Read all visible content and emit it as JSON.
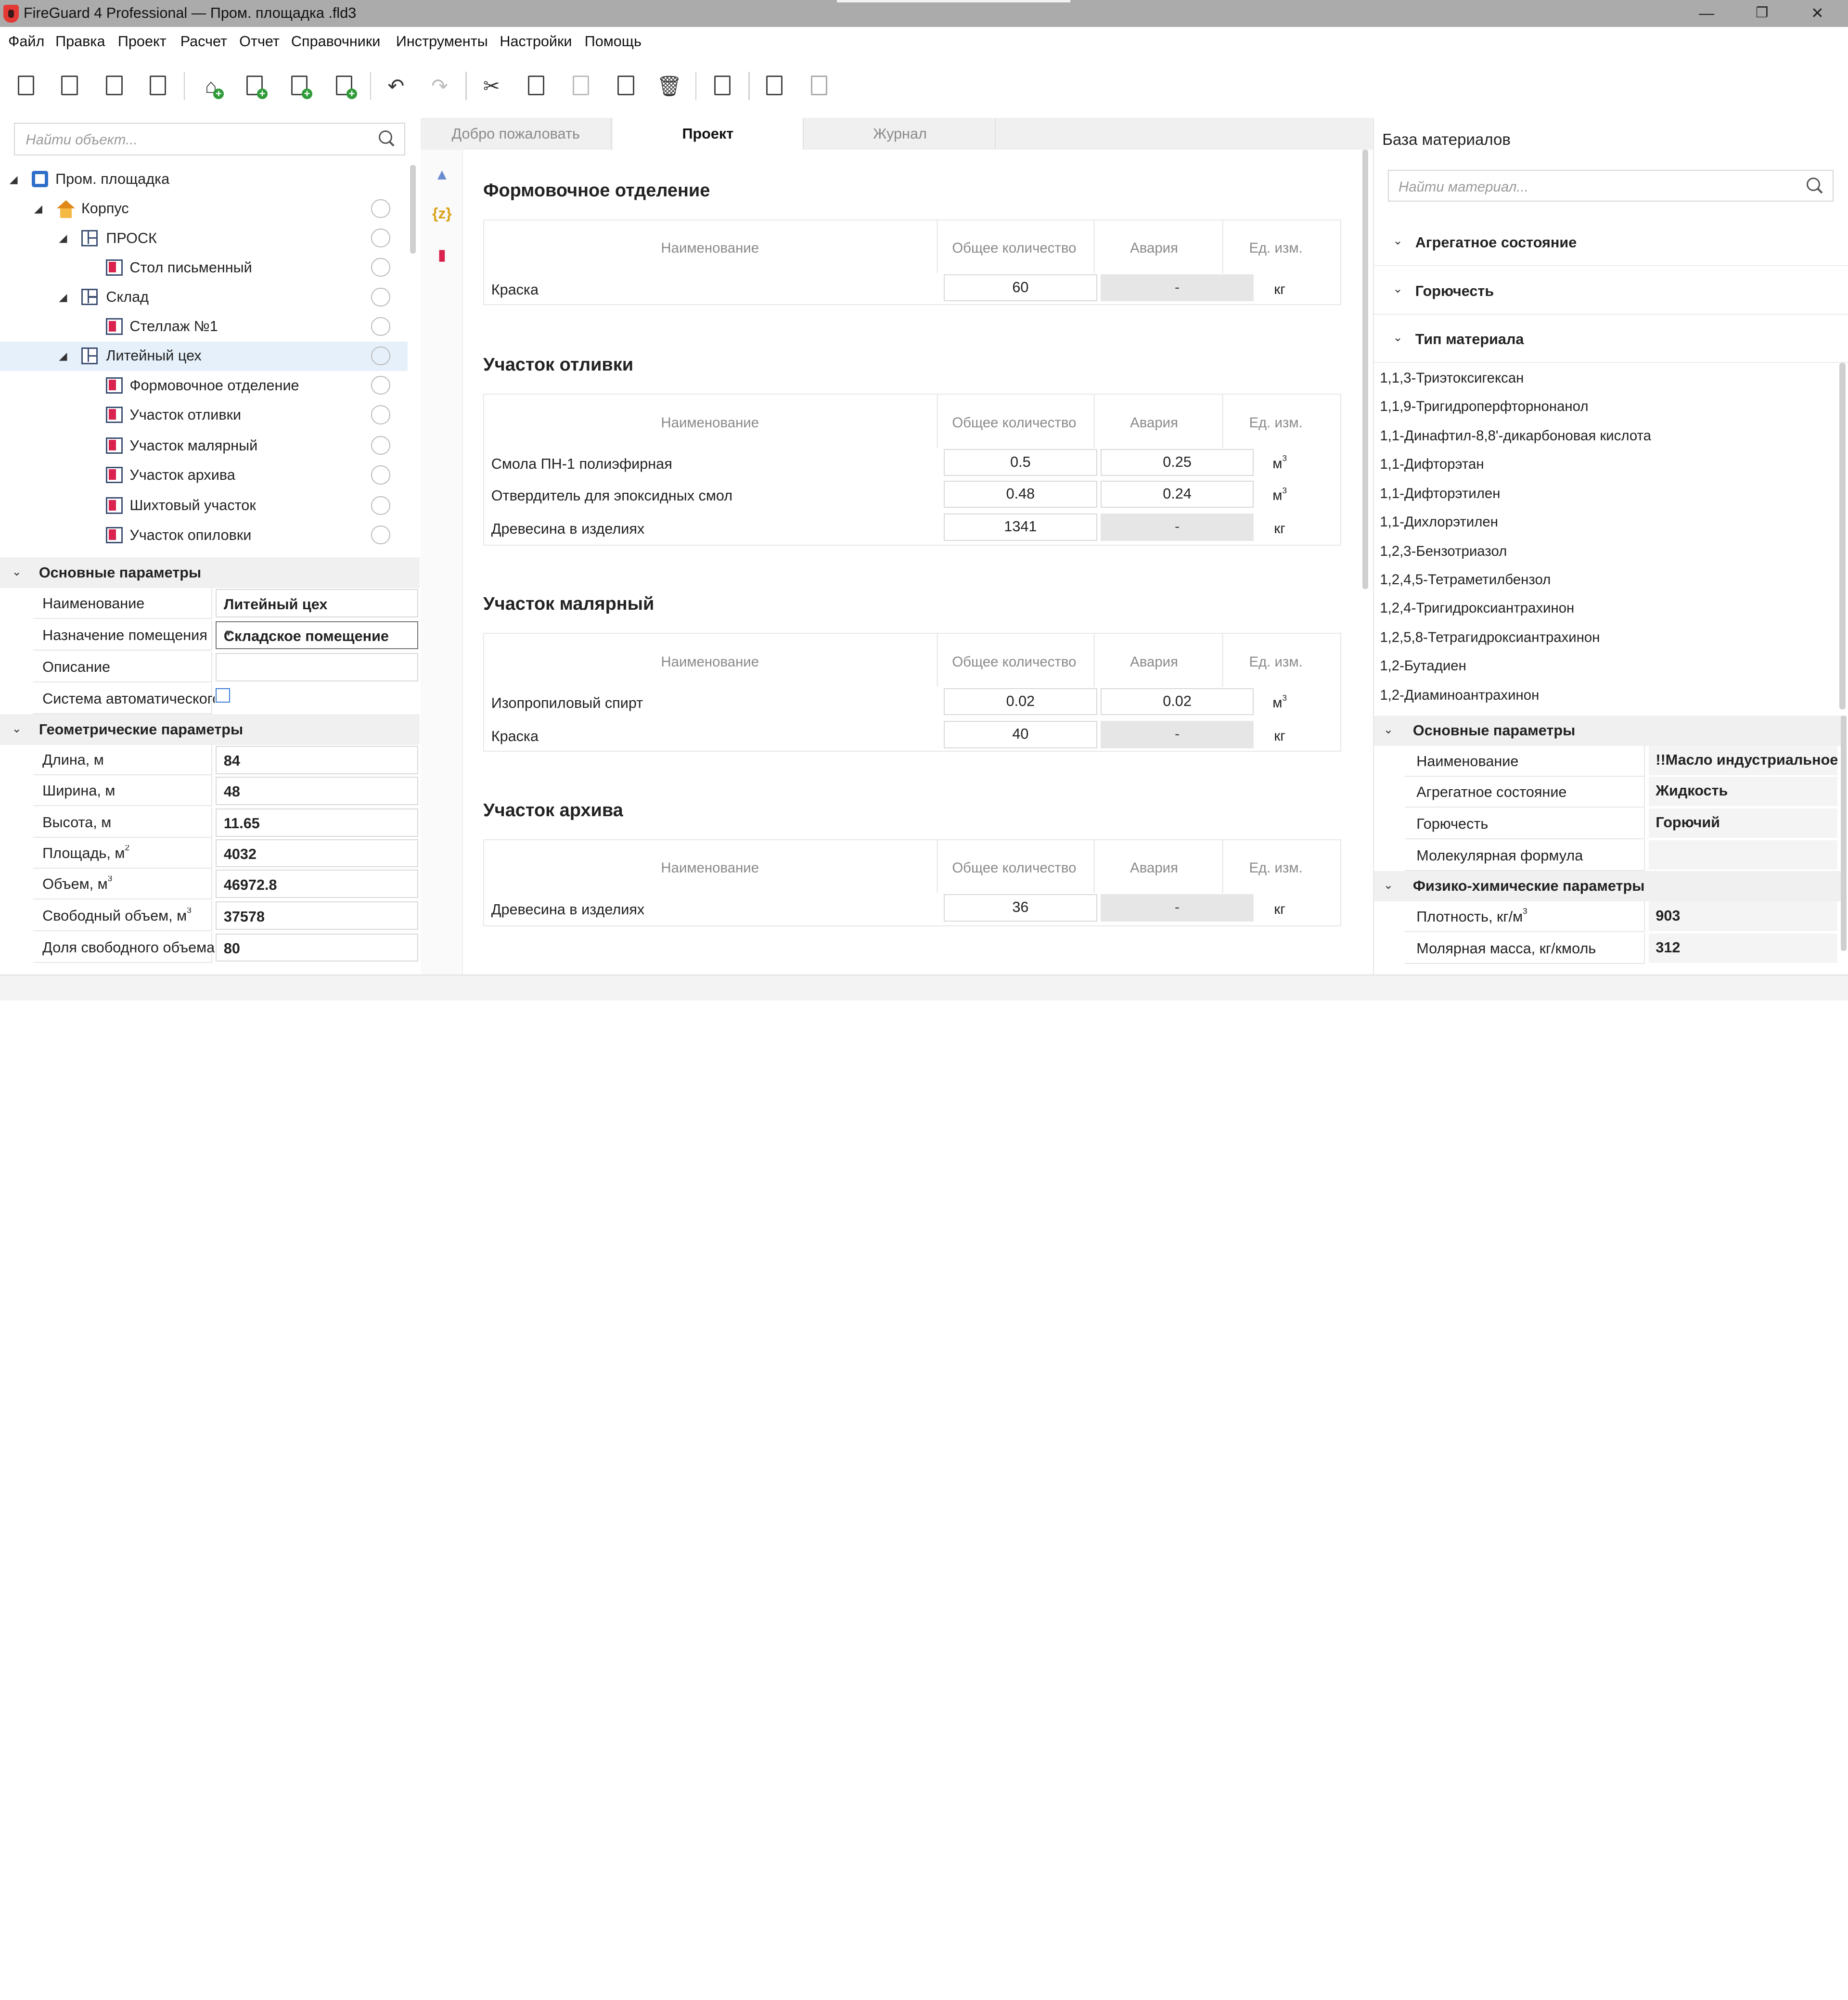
{
  "window": {
    "title": "FireGuard 4 Professional — Пром. площадка .fld3"
  },
  "menu": [
    "Файл",
    "Правка",
    "Проект",
    "Расчет",
    "Отчет",
    "Справочники",
    "Инструменты",
    "Настройки",
    "Помощь"
  ],
  "tree": {
    "search_placeholder": "Найти объект...",
    "items": [
      {
        "label": "Пром. площадка",
        "icon": "project-icon"
      },
      {
        "label": "Корпус",
        "icon": "house-icon"
      },
      {
        "label": "ПРОСК",
        "icon": "building-icon"
      },
      {
        "label": "Стол письменный",
        "icon": "room-icon"
      },
      {
        "label": "Склад",
        "icon": "building-icon"
      },
      {
        "label": "Стеллаж №1",
        "icon": "room-icon"
      },
      {
        "label": "Литейный цех",
        "icon": "building-icon"
      },
      {
        "label": "Формовочное отделение",
        "icon": "room-icon"
      },
      {
        "label": "Участок отливки",
        "icon": "room-icon"
      },
      {
        "label": "Участок малярный",
        "icon": "room-icon"
      },
      {
        "label": "Участок архива",
        "icon": "room-icon"
      },
      {
        "label": "Шихтовый участок",
        "icon": "room-icon"
      },
      {
        "label": "Участок опиловки",
        "icon": "room-icon"
      }
    ]
  },
  "basic": {
    "title": "Основные параметры",
    "rows": [
      {
        "label": "Наименование",
        "value": "Литейный цех"
      },
      {
        "label": "Назначение помещения",
        "value": "Складское помещение"
      },
      {
        "label": "Описание",
        "value": ""
      },
      {
        "label": "Система автоматического",
        "value": ""
      }
    ]
  },
  "geom": {
    "title": "Геометрические параметры",
    "rows": [
      {
        "label": "Длина, м",
        "value": "84"
      },
      {
        "label": "Ширина, м",
        "value": "48"
      },
      {
        "label": "Высота, м",
        "value": "11.65"
      },
      {
        "label": "Площадь, м",
        "sup": "2",
        "value": "4032"
      },
      {
        "label": "Объем, м",
        "sup": "3",
        "value": "46972.8"
      },
      {
        "label": "Свободный объем, м",
        "sup": "3",
        "value": "37578"
      },
      {
        "label": "Доля свободного объема",
        "value": "80"
      }
    ]
  },
  "tabs": [
    "Добро пожаловать",
    "Проект",
    "Журнал"
  ],
  "headers": {
    "name": "Наименование",
    "total": "Общее количество",
    "alarm": "Авария",
    "unit": "Ед. изм."
  },
  "sections": [
    {
      "title": "Формовочное отделение",
      "rows": [
        {
          "name": "Краска",
          "total": "60",
          "alarm": "-",
          "unit": "кг"
        }
      ]
    },
    {
      "title": "Участок отливки",
      "rows": [
        {
          "name": "Смола ПН-1 полиэфирная",
          "total": "0.5",
          "alarm": "0.25",
          "unit": "м",
          "sup": "3"
        },
        {
          "name": "Отвердитель для эпоксидных смол",
          "total": "0.48",
          "alarm": "0.24",
          "unit": "м",
          "sup": "3"
        },
        {
          "name": "Древесина в изделиях",
          "total": "1341",
          "alarm": "-",
          "unit": "кг"
        }
      ]
    },
    {
      "title": "Участок малярный",
      "rows": [
        {
          "name": "Изопропиловый спирт",
          "total": "0.02",
          "alarm": "0.02",
          "unit": "м",
          "sup": "3"
        },
        {
          "name": "Краска",
          "total": "40",
          "alarm": "-",
          "unit": "кг"
        }
      ]
    },
    {
      "title": "Участок архива",
      "rows": [
        {
          "name": "Древесина в изделиях",
          "total": "36",
          "alarm": "-",
          "unit": "кг"
        }
      ]
    }
  ],
  "materials": {
    "title": "База материалов",
    "search_placeholder": "Найти материал...",
    "filters": [
      "Агрегатное состояние",
      "Горючесть",
      "Тип материала"
    ],
    "list": [
      "1,1,3-Триэтоксигексан",
      "1,1,9-Тригидроперфторнонанол",
      "1,1-Динафтил-8,8'-дикарбоновая кислота",
      "1,1-Дифторэтан",
      "1,1-Дифторэтилен",
      "1,1-Дихлорэтилен",
      "1,2,3-Бензотриазол",
      "1,2,4,5-Тетраметилбензол",
      "1,2,4-Тригидроксиантрахинон",
      "1,2,5,8-Тетрагидроксиантрахинон",
      "1,2-Бутадиен",
      "1,2-Диаминоантрахинон"
    ],
    "basic_title": "Основные параметры",
    "basic": [
      {
        "label": "Наименование",
        "value": "!!Масло индустриальное"
      },
      {
        "label": "Агрегатное состояние",
        "value": "Жидкость"
      },
      {
        "label": "Горючесть",
        "value": "Горючий"
      },
      {
        "label": "Молекулярная формула",
        "value": ""
      }
    ],
    "phys_title": "Физико-химические параметры",
    "phys": [
      {
        "label": "Плотность, кг/м",
        "sup": "3",
        "value": "903"
      },
      {
        "label": "Молярная масса, кг/кмоль",
        "value": "312"
      }
    ]
  }
}
